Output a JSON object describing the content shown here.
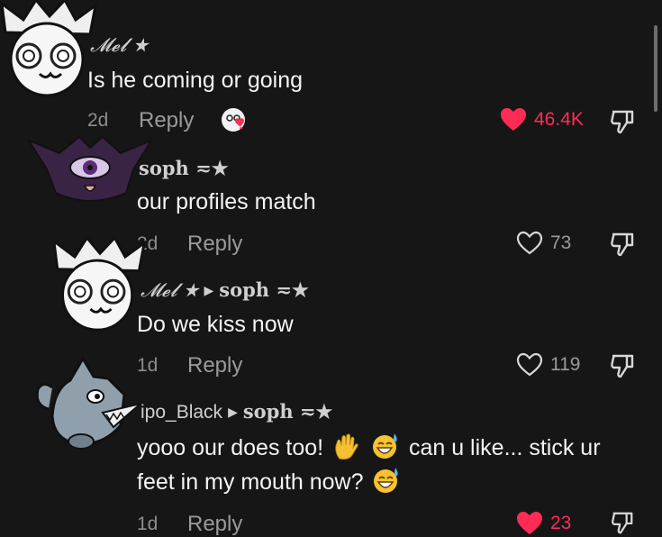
{
  "comments": [
    {
      "username": "𝓜𝓮𝓵 ★",
      "text": "Is he coming or going",
      "age": "2d",
      "reply_label": "Reply",
      "likes": "46.4K",
      "liked": true,
      "avatar_icon": "white-cat-crown-avatar-icon"
    },
    {
      "username": "soph ≂★",
      "text": "our profiles match",
      "age": "2d",
      "reply_label": "Reply",
      "likes": "73",
      "liked": false,
      "avatar_icon": "purple-one-eyed-creature-avatar-icon"
    },
    {
      "username": "𝓜𝓮𝓵 ★",
      "reply_to": "soph ≂★",
      "text": "Do we kiss now",
      "age": "1d",
      "reply_label": "Reply",
      "likes": "119",
      "liked": false,
      "avatar_icon": "white-cat-crown-avatar-icon"
    },
    {
      "username": "ipo_Black",
      "reply_to": "soph ≂★",
      "text_line1_a": "yooo our does too!",
      "text_line1_b": "can u like... stick ur",
      "text_line2": "feet in my mouth now?",
      "age": "1d",
      "reply_label": "Reply",
      "likes": "23",
      "liked": true,
      "avatar_icon": "blue-shark-cat-avatar-icon"
    }
  ],
  "colors": {
    "background": "#161616",
    "like_active": "#fe2c55",
    "meta_gray": "#9a9a9a"
  }
}
